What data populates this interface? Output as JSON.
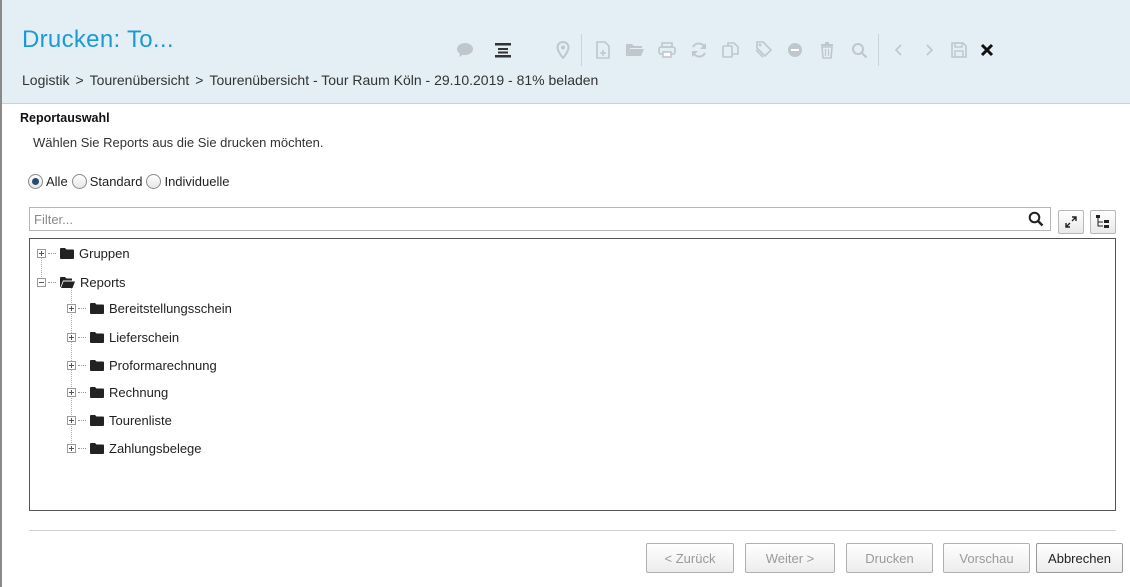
{
  "header": {
    "title": "Drucken: To...",
    "breadcrumb": [
      "Logistik",
      "Tourenübersicht",
      "Tourenübersicht - Tour Raum Köln - 29.10.2019 - 81% beladen"
    ],
    "breadcrumb_separator": ">",
    "toolbar_icons": [
      "comment-icon",
      "list-icon",
      "pin-icon",
      "new-document-icon",
      "open-folder-icon",
      "print-icon",
      "refresh-icon",
      "copy-icon",
      "tag-icon",
      "minus-circle-icon",
      "trash-icon",
      "search-icon",
      "chevron-left-icon",
      "chevron-right-icon",
      "save-icon",
      "close-icon"
    ]
  },
  "section": {
    "title": "Reportauswahl",
    "subtitle": "Wählen Sie Reports aus die Sie drucken möchten."
  },
  "radios": {
    "options": [
      "Alle",
      "Standard",
      "Individuelle"
    ],
    "selected": "Alle"
  },
  "filter": {
    "placeholder": "Filter..."
  },
  "tree": {
    "groups_label": "Gruppen",
    "reports_label": "Reports",
    "report_items": [
      "Bereitstellungsschein",
      "Lieferschein",
      "Proformarechnung",
      "Rechnung",
      "Tourenliste",
      "Zahlungsbelege"
    ]
  },
  "buttons": {
    "back": "< Zurück",
    "next": "Weiter >",
    "print": "Drucken",
    "preview": "Vorschau",
    "cancel": "Abbrechen"
  },
  "colors": {
    "title": "#1a9bd7",
    "header_bg": "#e4eef5"
  }
}
